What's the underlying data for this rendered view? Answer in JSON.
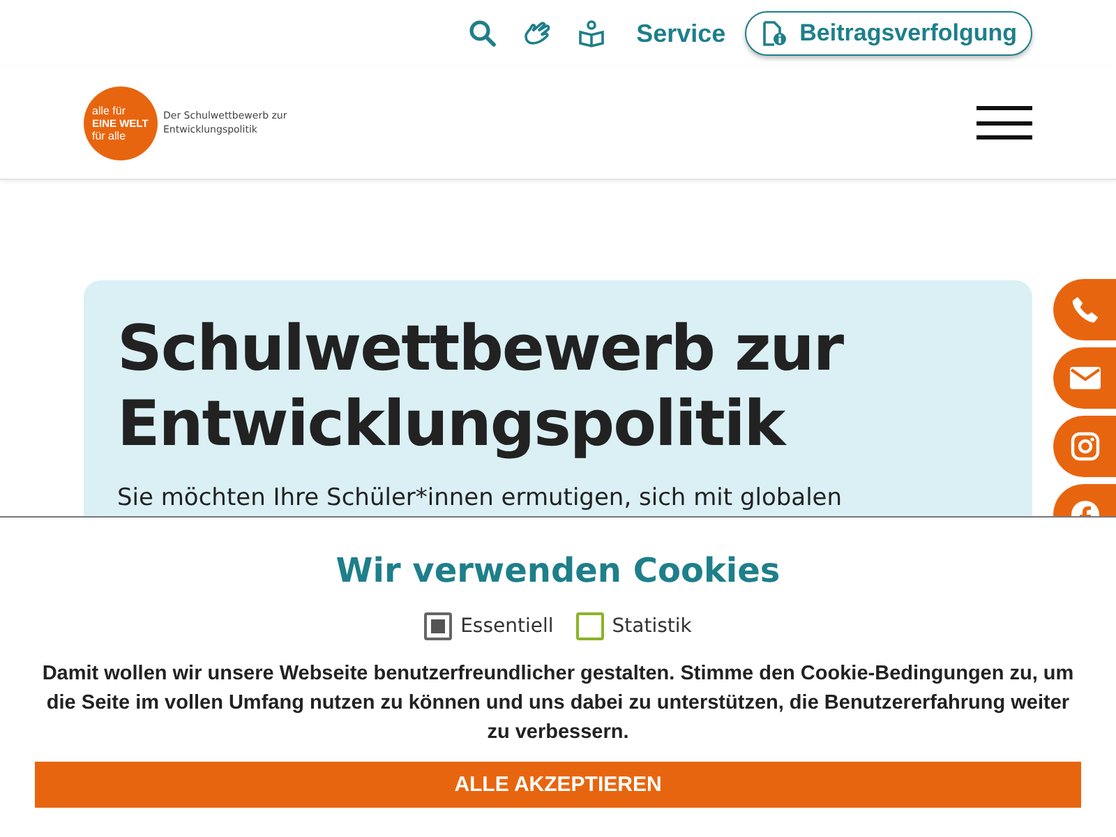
{
  "top_nav": {
    "items": [
      {
        "kind": "search"
      },
      {
        "kind": "sign"
      },
      {
        "kind": "reader"
      },
      {
        "kind": "text",
        "label": "Service"
      }
    ],
    "tracking_button": "Beitragsverfolgung"
  },
  "logo": {
    "lines": [
      "alle für",
      "EINE WELT",
      "für alle"
    ],
    "tagline": "Der Schulwettbewerb zur Entwicklungspolitik"
  },
  "hero": {
    "title": "Schulwettbewerb zur Entwicklungspolitik",
    "text": "Sie möchten Ihre Schüler*innen ermutigen, sich mit globalen"
  },
  "social": [
    {
      "kind": "phone"
    },
    {
      "kind": "mail"
    },
    {
      "kind": "instagram"
    },
    {
      "kind": "facebook"
    }
  ],
  "cookie_banner": {
    "title": "Wir verwenden Cookies",
    "options": [
      {
        "label": "Essentiell",
        "checked": true,
        "disabled": true
      },
      {
        "label": "Statistik",
        "checked": false,
        "disabled": false
      }
    ],
    "text": "Damit wollen wir unsere Webseite benutzerfreundlicher gestalten. Stimme den Cookie-Bedingungen zu, um die Seite im vollen Umfang nutzen zu können und uns dabei zu unterstützen, die Benutzererfahrung weiter zu verbessern.",
    "accept_button": "ALLE AKZEPTIEREN"
  }
}
